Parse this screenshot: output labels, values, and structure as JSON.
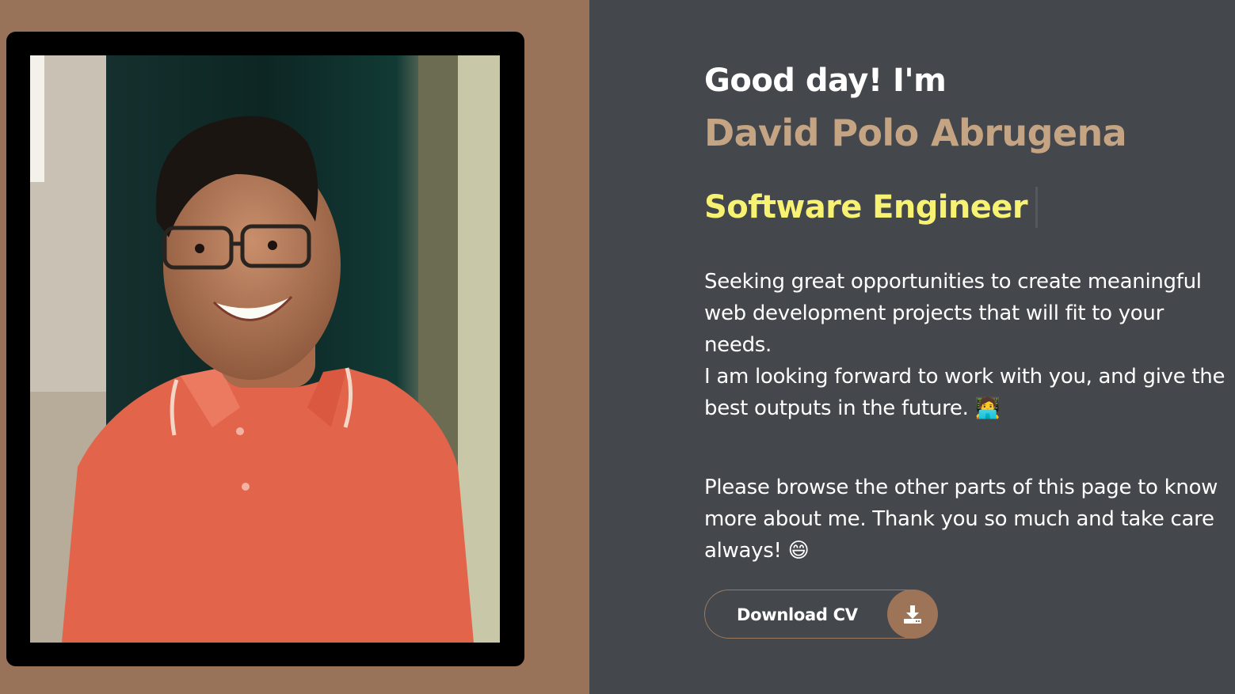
{
  "hero": {
    "greeting": "Good day! I'm",
    "name": "David Polo Abrugena",
    "role": "Software Engineer",
    "bio": {
      "paragraph1_line1": "Seeking great opportunities to create meaningful web development projects that will fit to your needs.",
      "paragraph1_line2": "I am looking forward to work with you, and give the best outputs in the future.",
      "paragraph1_emoji": "🧑‍💻",
      "paragraph2": "Please browse the other parts of this page to know more about me. Thank you so much and take care always!",
      "paragraph2_emoji": "😄"
    },
    "download_button": {
      "label": "Download CV",
      "icon": "download-icon"
    }
  },
  "colors": {
    "left_panel": "#987259",
    "right_panel": "#44474b",
    "name": "#c5a484",
    "role": "#f7f271",
    "button_icon_bg": "#9d7458"
  }
}
